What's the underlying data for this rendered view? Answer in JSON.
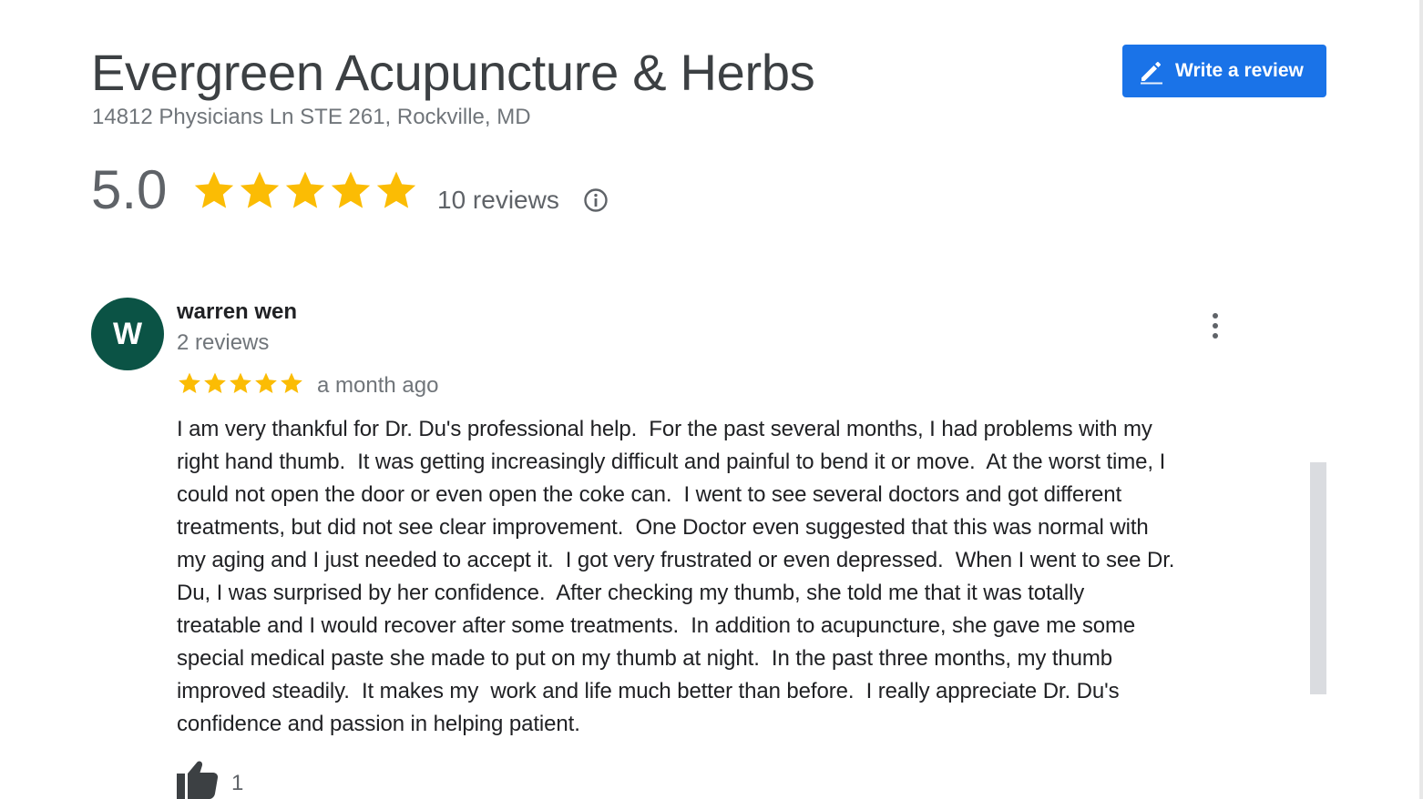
{
  "business": {
    "name": "Evergreen Acupuncture & Herbs",
    "address": "14812 Physicians Ln STE 261, Rockville, MD"
  },
  "actions": {
    "write_review_label": "Write a review"
  },
  "summary": {
    "rating": "5.0",
    "stars": 5,
    "review_count": "10 reviews",
    "star_color": "#fbbc04"
  },
  "review": {
    "avatar_letter": "W",
    "avatar_color": "#0b5345",
    "author": "warren wen",
    "author_reviews": "2 reviews",
    "stars": 5,
    "time": "a month ago",
    "text_lines": [
      "I am very thankful for Dr. Du's professional help.  For the past several months, I had problems with my",
      "right hand thumb.  It was getting increasingly difficult and painful to bend it or move.  At the worst time, I",
      "could not open the door or even open the coke can.  I went to see several doctors and got different",
      "treatments, but did not see clear improvement.  One Doctor even suggested that this was normal with",
      "my aging and I just needed to accept it.  I got very frustrated or even depressed.  When I went to see Dr.",
      "Du, I was surprised by her confidence.  After checking my thumb, she told me that it was totally",
      "treatable and I would recover after some treatments.  In addition to acupuncture, she gave me some",
      "special medical paste she made to put on my thumb at night.  In the past three months, my thumb",
      "improved steadily.  It makes my  work and life much better than before.  I really appreciate Dr. Du's",
      "confidence and passion in helping patient."
    ],
    "likes": "1"
  },
  "icons": {
    "write": "pencil-icon",
    "info": "info-icon",
    "menu": "more-vert-icon",
    "like": "thumbs-up-icon",
    "star": "star-icon"
  },
  "colors": {
    "primary_button": "#1a73e8"
  }
}
